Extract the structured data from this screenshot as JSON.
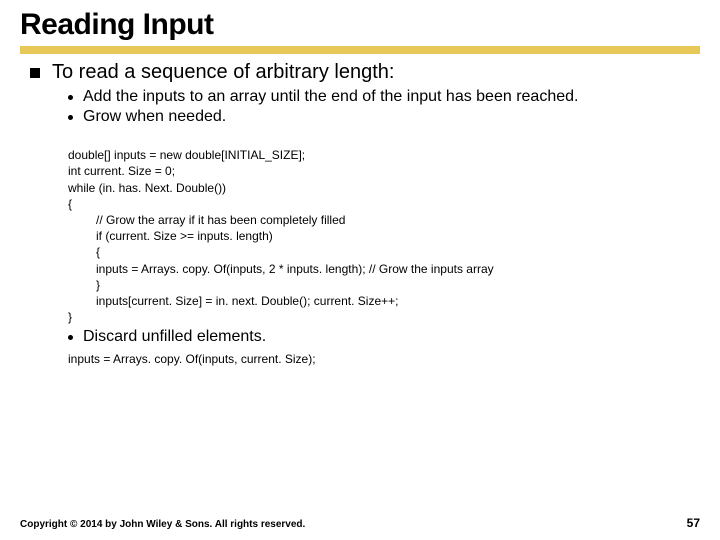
{
  "title": "Reading Input",
  "lvl1_1": "To read a sequence of arbitrary length:",
  "lvl2_1": "Add the inputs to an array until the end of the input has been reached.",
  "lvl2_2": "Grow when needed.",
  "code1": {
    "l1": "double[] inputs = new double[INITIAL_SIZE];",
    "l2": "int current. Size = 0;",
    "l3": "while (in. has. Next. Double())",
    "l4": "{",
    "l5": "// Grow the array if it has been completely filled",
    "l6": "if (current. Size >= inputs. length)",
    "l7": "{",
    "l8": "inputs = Arrays. copy. Of(inputs, 2 * inputs. length); // Grow the inputs array",
    "l9": "}",
    "l10": "inputs[current. Size] = in. next. Double(); current. Size++;",
    "l11": "}"
  },
  "lvl2_3": "Discard unfilled elements.",
  "code2": "inputs = Arrays. copy. Of(inputs, current. Size);",
  "copyright": "Copyright © 2014 by John Wiley & Sons. All rights reserved.",
  "page": "57"
}
